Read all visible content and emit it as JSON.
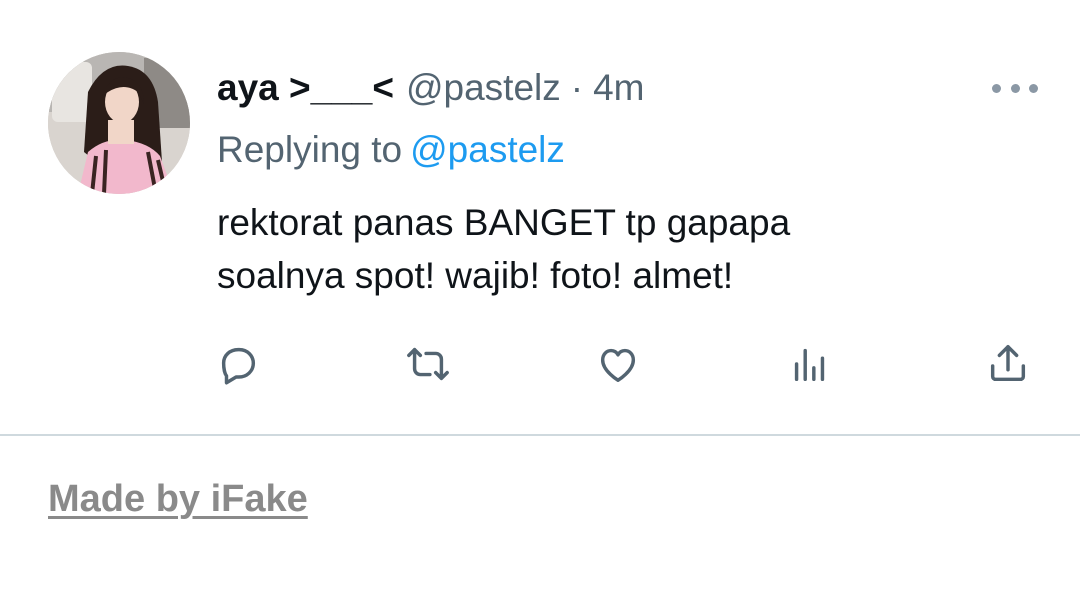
{
  "tweet": {
    "display_name": "aya >___<",
    "handle": "@pastelz",
    "separator": "·",
    "time": "4m",
    "replying_prefix": "Replying to",
    "replying_to": "@pastelz",
    "text_lines": [
      "rektorat panas BANGET tp gapapa",
      "soalnya spot! wajib! foto! almet!"
    ],
    "actions": [
      "reply-icon",
      "retweet-icon",
      "like-icon",
      "views-icon",
      "share-icon"
    ]
  },
  "footer": {
    "watermark": "Made by iFake"
  },
  "colors": {
    "text": "#0f1419",
    "secondary": "#536471",
    "link": "#1d9bf0",
    "divider": "#cfd9de",
    "watermark": "#8a8a8a"
  }
}
